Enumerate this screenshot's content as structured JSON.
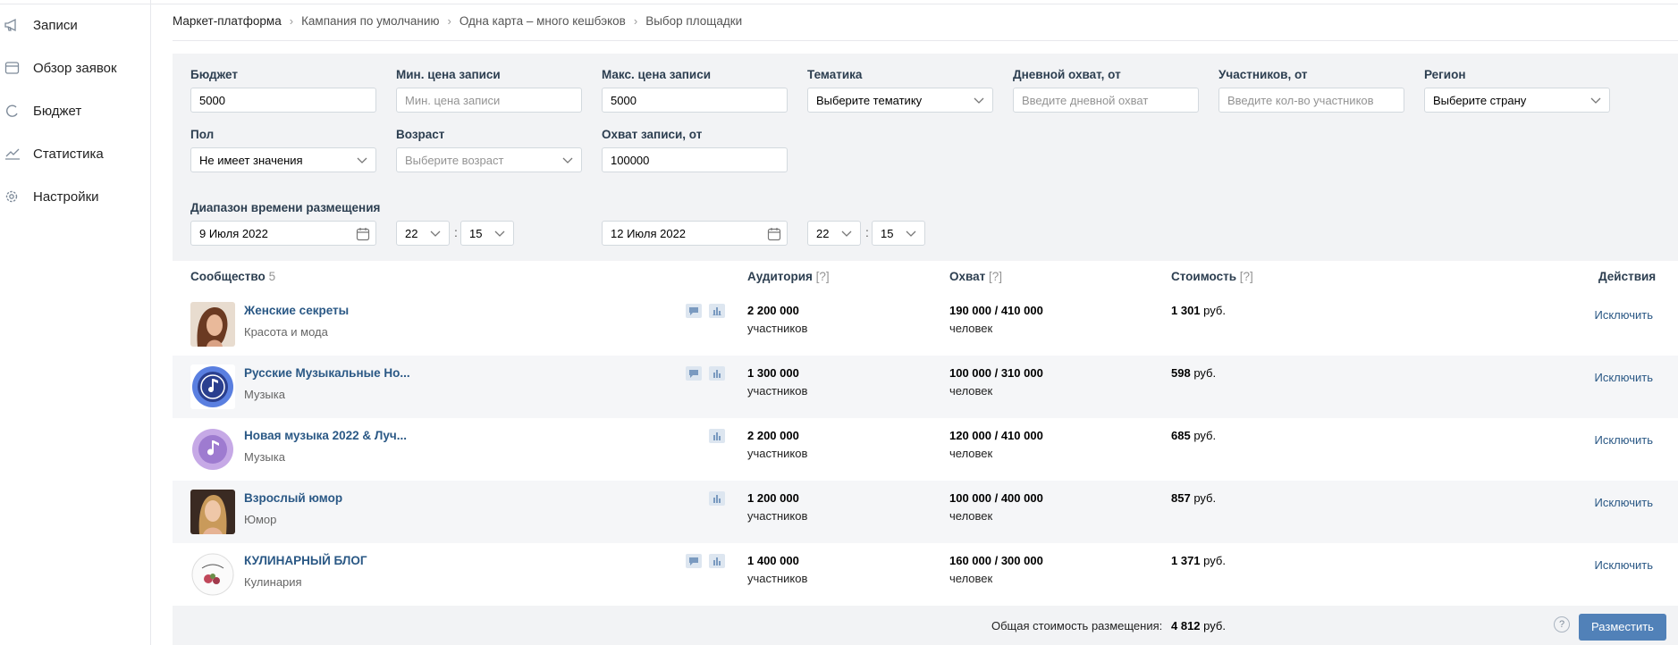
{
  "sidebar": {
    "items": [
      {
        "label": "Записи",
        "icon": "megaphone-icon"
      },
      {
        "label": "Обзор заявок",
        "icon": "card-icon"
      },
      {
        "label": "Бюджет",
        "icon": "pie-icon"
      },
      {
        "label": "Статистика",
        "icon": "chart-line-icon"
      },
      {
        "label": "Настройки",
        "icon": "gear-icon"
      }
    ]
  },
  "breadcrumb": [
    "Маркет-платформа",
    "Кампания по умолчанию",
    "Одна карта – много кешбэков",
    "Выбор площадки"
  ],
  "filters": {
    "budget": {
      "label": "Бюджет",
      "value": "5000"
    },
    "min_price": {
      "label": "Мин. цена записи",
      "placeholder": "Мин. цена записи"
    },
    "max_price": {
      "label": "Макс. цена записи",
      "value": "5000"
    },
    "topic": {
      "label": "Тематика",
      "value": "Выберите тематику"
    },
    "daily_reach": {
      "label": "Дневной охват, от",
      "placeholder": "Введите дневной охват"
    },
    "members": {
      "label": "Участников, от",
      "placeholder": "Введите кол-во участников"
    },
    "region": {
      "label": "Регион",
      "value": "Выберите страну"
    },
    "gender": {
      "label": "Пол",
      "value": "Не имеет значения"
    },
    "age": {
      "label": "Возраст",
      "value": "Выберите возраст"
    },
    "post_reach": {
      "label": "Охват записи, от",
      "value": "100000"
    },
    "range": {
      "label": "Диапазон времени размещения",
      "from_date": "9 Июля 2022",
      "from_hour": "22",
      "from_min": "15",
      "to_date": "12 Июля 2022",
      "to_hour": "22",
      "to_min": "15"
    }
  },
  "table": {
    "headers": {
      "community": "Сообщество",
      "community_count": "5",
      "audience": "Аудитория",
      "reach": "Охват",
      "cost": "Стоимость",
      "actions": "Действия",
      "help": "[?]"
    },
    "rows": [
      {
        "name": "Женские секреты",
        "category": "Красота и мода",
        "audience": "2 200 000",
        "audience_unit": "участников",
        "reach": "190 000 / 410 000",
        "reach_unit": "человек",
        "cost": "1 301",
        "cost_unit": "руб.",
        "action": "Исключить",
        "icons": [
          "comment-icon",
          "stats-icon"
        ],
        "avatar": "woman-portrait-icon"
      },
      {
        "name": "Русские Музыкальные Но...",
        "category": "Музыка",
        "audience": "1 300 000",
        "audience_unit": "участников",
        "reach": "100 000 / 310 000",
        "reach_unit": "человек",
        "cost": "598",
        "cost_unit": "руб.",
        "action": "Исключить",
        "icons": [
          "comment-icon",
          "stats-icon"
        ],
        "avatar": "music-note-icon"
      },
      {
        "name": "Новая музыка 2022 & Луч...",
        "category": "Музыка",
        "audience": "2 200 000",
        "audience_unit": "участников",
        "reach": "120 000 / 410 000",
        "reach_unit": "человек",
        "cost": "685",
        "cost_unit": "руб.",
        "action": "Исключить",
        "icons": [
          "stats-icon"
        ],
        "avatar": "music-note-icon"
      },
      {
        "name": "Взрослый юмор",
        "category": "Юмор",
        "audience": "1 200 000",
        "audience_unit": "участников",
        "reach": "100 000 / 400 000",
        "reach_unit": "человек",
        "cost": "857",
        "cost_unit": "руб.",
        "action": "Исключить",
        "icons": [
          "stats-icon"
        ],
        "avatar": "woman-portrait-icon"
      },
      {
        "name": "КУЛИНАРНЫЙ БЛОГ",
        "category": "Кулинария",
        "audience": "1 400 000",
        "audience_unit": "участников",
        "reach": "160 000 / 300 000",
        "reach_unit": "человек",
        "cost": "1 371",
        "cost_unit": "руб.",
        "action": "Исключить",
        "icons": [
          "comment-icon",
          "stats-icon"
        ],
        "avatar": "cooking-logo-icon"
      }
    ]
  },
  "footer": {
    "total_label": "Общая стоимость размещения:",
    "total_value": "4 812",
    "total_unit": "руб.",
    "help": "?",
    "place_button": "Разместить"
  },
  "colors": {
    "accent": "#5181b8",
    "link": "#2a5885",
    "panel": "#f2f3f5"
  }
}
